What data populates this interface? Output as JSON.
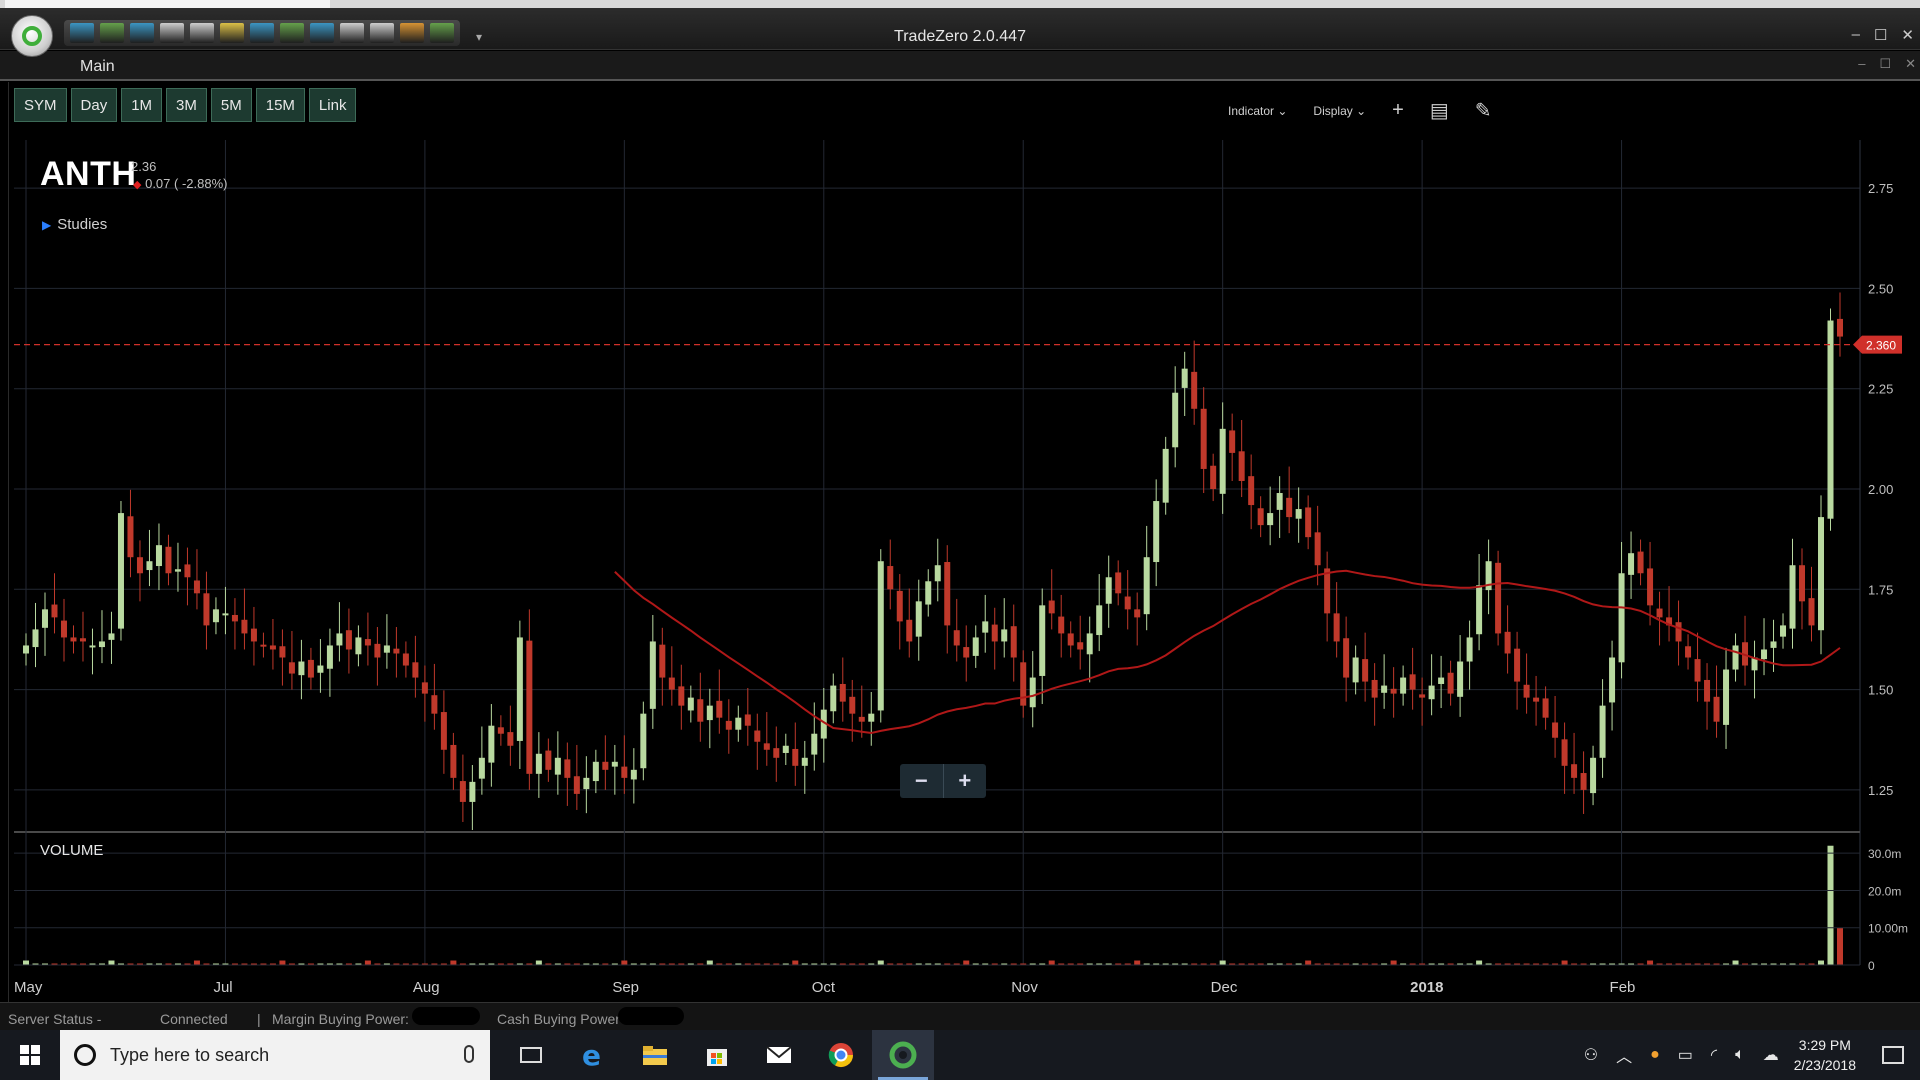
{
  "window": {
    "title": "TradeZero 2.0.447",
    "controls": [
      "–",
      "☐",
      "✕"
    ]
  },
  "menu": {
    "main_label": "Main",
    "controls": [
      "–",
      "☐",
      "✕"
    ]
  },
  "toolbar": {
    "icons": [
      "chart-icon",
      "bar-chart-icon",
      "trend-icon",
      "grid-icon",
      "dollar-icon",
      "note-icon",
      "list-icon",
      "scan-icon",
      "transfer-icon",
      "globe-icon",
      "search-icon",
      "settings-icon",
      "map-icon"
    ],
    "icon_colors": [
      "#3aa3d8",
      "#6ab04c",
      "#3aa3d8",
      "#e6e6e6",
      "#e6e6e6",
      "#f5d547",
      "#3aa3d8",
      "#6ab04c",
      "#3aa3d8",
      "#e6e6e6",
      "#e6e6e6",
      "#f0a030",
      "#6ab04c"
    ]
  },
  "period_buttons": [
    "SYM",
    "Day",
    "1M",
    "3M",
    "5M",
    "15M",
    "Link"
  ],
  "chart_tools": {
    "indicator": "Indicator",
    "display": "Display"
  },
  "symbol": {
    "name": "ANTH",
    "price": "2.36",
    "change": "0.07 ( -2.88%)"
  },
  "studies_label": "Studies",
  "volume_label": "VOLUME",
  "zoom": {
    "minus": "−",
    "plus": "+"
  },
  "chart_data": {
    "type": "candlestick",
    "title": "",
    "series_colors": {
      "up": "#b9d9a0",
      "down": "#c0392b",
      "ma": "#b01818",
      "last_price": "#d0302a",
      "grid": "#232833"
    },
    "x_ticks": [
      "May",
      "Jul",
      "Aug",
      "Sep",
      "Oct",
      "Nov",
      "Dec",
      "2018",
      "Feb"
    ],
    "y_ticks": [
      "2.75",
      "2.50",
      "2.25",
      "2.00",
      "1.75",
      "1.50",
      "1.25"
    ],
    "y_range": [
      1.15,
      2.87
    ],
    "last_price": 2.36,
    "last_price_label": "2.360",
    "volume_ticks": [
      "30.0m",
      "20.0m",
      "10.00m",
      "0"
    ],
    "volume_range": [
      0,
      33
    ],
    "volume_spike": {
      "up": 32,
      "down": 10
    },
    "closes": [
      1.61,
      1.65,
      1.7,
      1.68,
      1.63,
      1.62,
      1.62,
      1.61,
      1.62,
      1.64,
      1.94,
      1.83,
      1.79,
      1.82,
      1.86,
      1.79,
      1.8,
      1.78,
      1.74,
      1.66,
      1.7,
      1.69,
      1.67,
      1.64,
      1.62,
      1.61,
      1.6,
      1.58,
      1.54,
      1.57,
      1.53,
      1.56,
      1.61,
      1.64,
      1.6,
      1.63,
      1.61,
      1.58,
      1.61,
      1.59,
      1.56,
      1.53,
      1.49,
      1.44,
      1.35,
      1.28,
      1.22,
      1.27,
      1.33,
      1.41,
      1.39,
      1.36,
      1.63,
      1.29,
      1.34,
      1.3,
      1.33,
      1.28,
      1.24,
      1.28,
      1.32,
      1.3,
      1.32,
      1.28,
      1.3,
      1.44,
      1.62,
      1.53,
      1.5,
      1.46,
      1.48,
      1.42,
      1.46,
      1.43,
      1.4,
      1.43,
      1.41,
      1.37,
      1.35,
      1.33,
      1.36,
      1.31,
      1.33,
      1.39,
      1.45,
      1.51,
      1.47,
      1.44,
      1.42,
      1.44,
      1.82,
      1.75,
      1.67,
      1.62,
      1.72,
      1.77,
      1.81,
      1.66,
      1.61,
      1.58,
      1.63,
      1.67,
      1.62,
      1.65,
      1.58,
      1.46,
      1.53,
      1.71,
      1.69,
      1.64,
      1.61,
      1.6,
      1.64,
      1.71,
      1.78,
      1.74,
      1.7,
      1.68,
      1.83,
      1.97,
      2.1,
      2.24,
      2.3,
      2.2,
      2.05,
      2.0,
      2.15,
      2.09,
      2.02,
      1.96,
      1.91,
      1.94,
      1.99,
      1.93,
      1.95,
      1.88,
      1.81,
      1.69,
      1.62,
      1.53,
      1.58,
      1.52,
      1.48,
      1.51,
      1.49,
      1.53,
      1.5,
      1.48,
      1.51,
      1.53,
      1.49,
      1.57,
      1.63,
      1.76,
      1.82,
      1.64,
      1.59,
      1.52,
      1.48,
      1.47,
      1.43,
      1.38,
      1.31,
      1.28,
      1.25,
      1.33,
      1.46,
      1.58,
      1.79,
      1.84,
      1.79,
      1.71,
      1.68,
      1.66,
      1.62,
      1.58,
      1.52,
      1.47,
      1.42,
      1.55,
      1.61,
      1.56,
      1.58,
      1.6,
      1.62,
      1.66,
      1.81,
      1.72,
      1.66,
      1.93,
      2.42,
      2.38
    ]
  },
  "status": {
    "server_status_label": "Server Status -",
    "server_status_value": "Connected",
    "separator": "|",
    "margin_label": "Margin Buying Power:",
    "cash_label": "Cash Buying Power"
  },
  "taskbar": {
    "search_placeholder": "Type here to search",
    "time": "3:29 PM",
    "date": "2/23/2018"
  }
}
